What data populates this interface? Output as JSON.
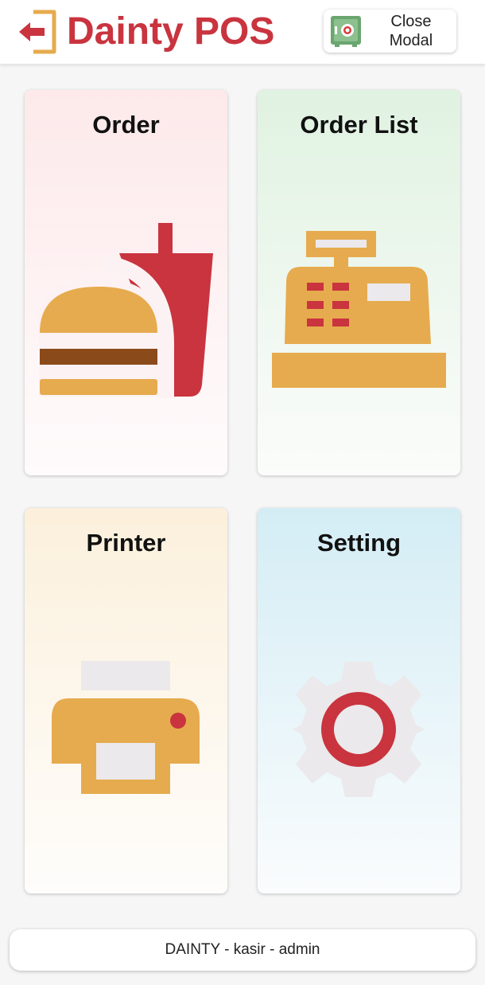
{
  "header": {
    "logout_icon": "logout-arrow-icon",
    "title": "Dainty POS",
    "close_modal_label_line1": "Close",
    "close_modal_label_line2": "Modal",
    "close_modal_icon": "safe-icon"
  },
  "menu": {
    "order": {
      "label": "Order",
      "icon": "burger-drink-icon"
    },
    "order_list": {
      "label": "Order List",
      "icon": "cash-register-icon"
    },
    "printer": {
      "label": "Printer",
      "icon": "printer-icon"
    },
    "setting": {
      "label": "Setting",
      "icon": "gear-icon"
    }
  },
  "footer": {
    "status_text": "DAINTY - kasir - admin"
  },
  "colors": {
    "brand_red": "#c9343f",
    "accent_orange": "#e6ab4e",
    "brown": "#8b4a1a",
    "light_gray": "#ebe9eb",
    "safe_green": "#6aa66e"
  }
}
